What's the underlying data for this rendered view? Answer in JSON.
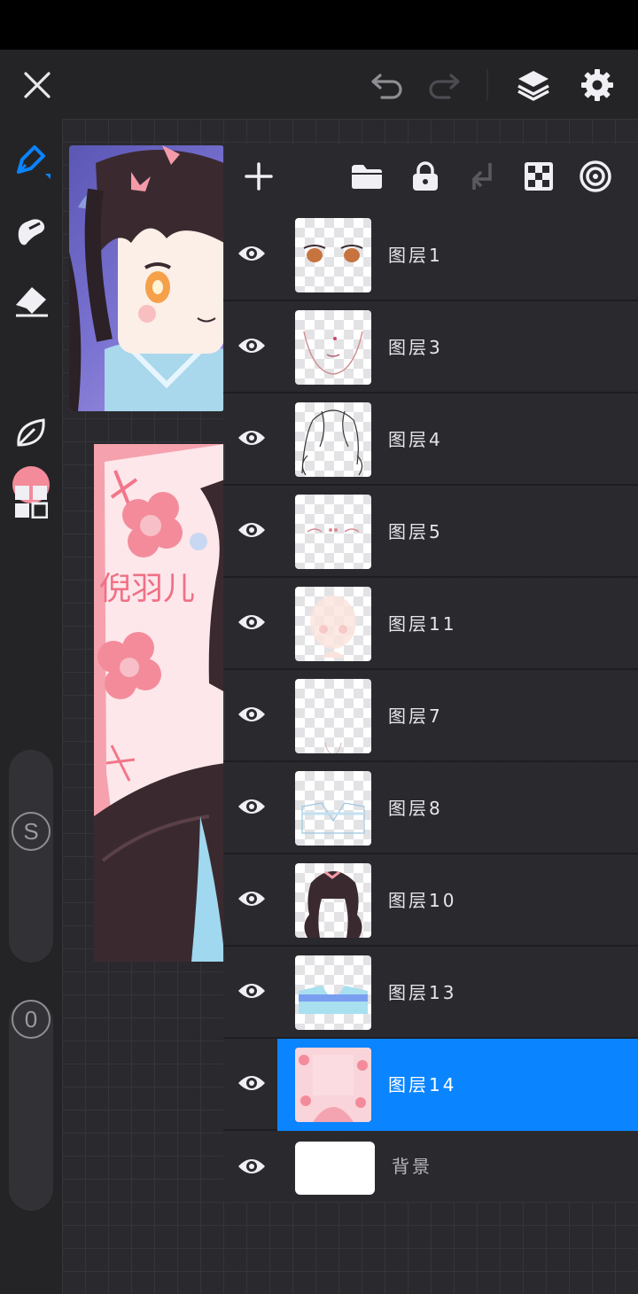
{
  "colors": {
    "accent": "#0a84ff",
    "brush_color": "#f48b9b",
    "panel_bg": "#2a2a2e",
    "toolbar_bg": "#242427"
  },
  "topbar": {
    "icons": [
      "close-icon",
      "undo-icon",
      "redo-icon",
      "layers-icon",
      "gear-icon"
    ]
  },
  "left_toolbar": {
    "tools": [
      "pen-icon",
      "smudge-icon",
      "eraser-icon",
      "color-swatch",
      "leaf-icon",
      "grid-icon"
    ],
    "size_slider_label": "S",
    "opacity_slider_label": "0"
  },
  "layer_panel": {
    "header_icons": [
      "add-icon",
      "folder-icon",
      "lock-icon",
      "merge-down-icon",
      "checkerboard-icon",
      "blend-icon"
    ],
    "layers": [
      {
        "name": "图层1",
        "visible": true,
        "selected": false
      },
      {
        "name": "图层3",
        "visible": true,
        "selected": false
      },
      {
        "name": "图层4",
        "visible": true,
        "selected": false
      },
      {
        "name": "图层5",
        "visible": true,
        "selected": false
      },
      {
        "name": "图层11",
        "visible": true,
        "selected": false
      },
      {
        "name": "图层7",
        "visible": true,
        "selected": false
      },
      {
        "name": "图层8",
        "visible": true,
        "selected": false
      },
      {
        "name": "图层10",
        "visible": true,
        "selected": false
      },
      {
        "name": "图层13",
        "visible": true,
        "selected": false
      },
      {
        "name": "图层14",
        "visible": true,
        "selected": true
      }
    ],
    "background_layer": {
      "name": "背景",
      "visible": true
    }
  },
  "artwork": {
    "banner_text": "倪羽儿"
  }
}
